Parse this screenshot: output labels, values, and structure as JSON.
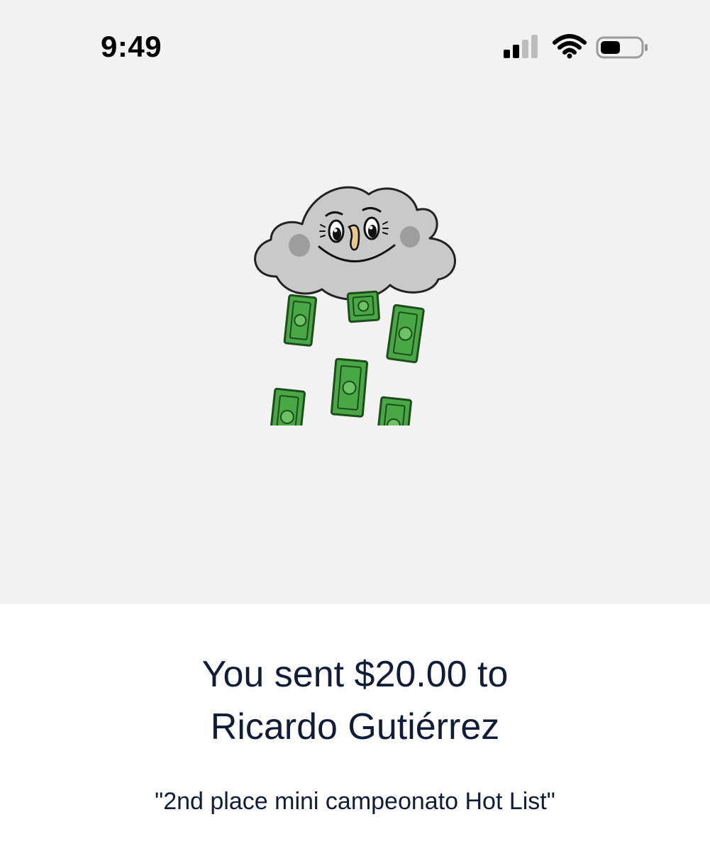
{
  "status_bar": {
    "time": "9:49",
    "icons": [
      "signal-icon",
      "wifi-icon",
      "battery-icon"
    ]
  },
  "illustration": {
    "name": "money-rain-cloud"
  },
  "payment": {
    "headline_line1": "You sent $20.00 to",
    "headline_line2": "Ricardo Gutiérrez",
    "note": "\"2nd place mini campeonato Hot List\""
  },
  "colors": {
    "background_top": "#f2f2f2",
    "background_bottom": "#ffffff",
    "text": "#0f1d3a",
    "cloud": "#c9c9c9",
    "cash": "#3f9a3a"
  }
}
